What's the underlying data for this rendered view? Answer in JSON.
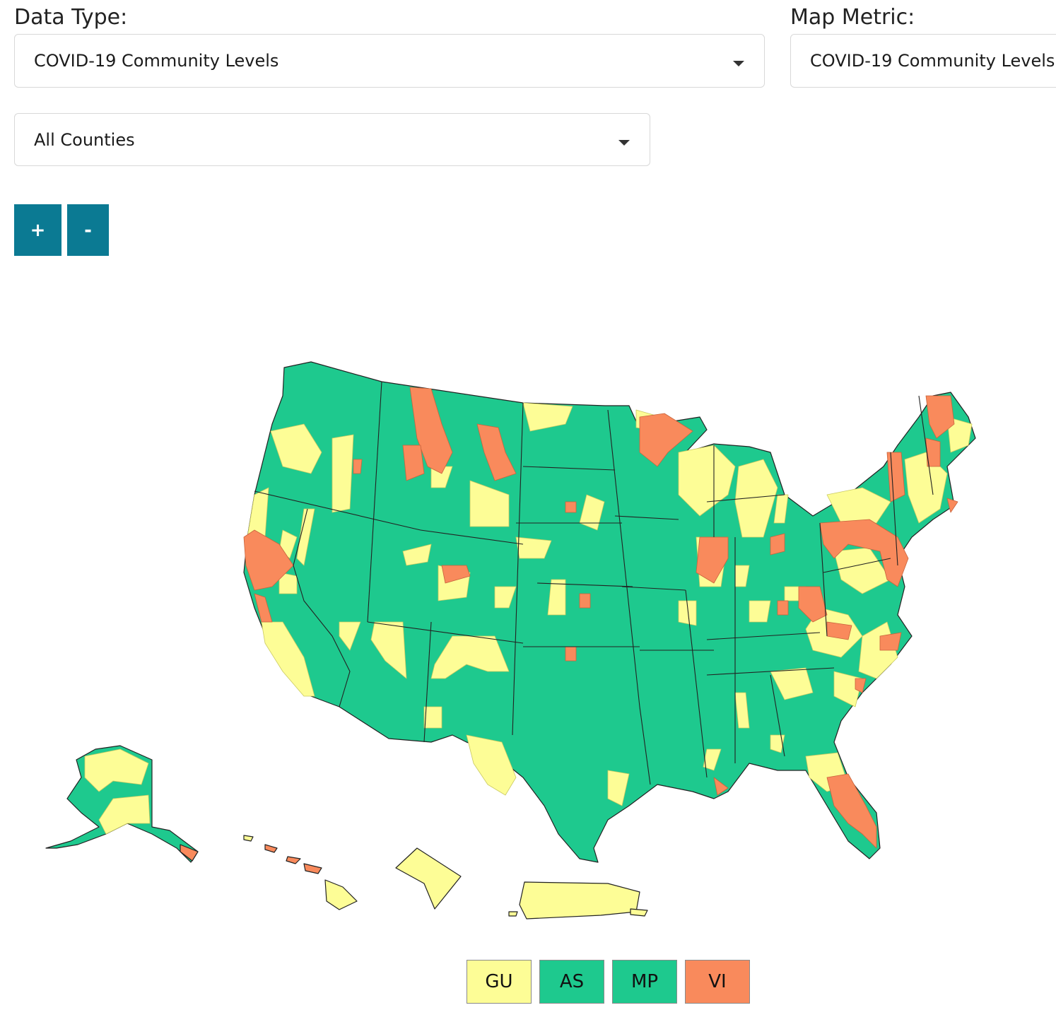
{
  "filters": {
    "data_type_label": "Data Type:",
    "data_type_value": "COVID-19 Community Levels",
    "map_metric_label": "Map Metric:",
    "map_metric_value": "COVID-19 Community Levels",
    "county_scope_value": "All Counties"
  },
  "zoom": {
    "zoom_in_label": "+",
    "zoom_out_label": "-"
  },
  "legend": [
    {
      "label": "GU",
      "color": "#fdfd96"
    },
    {
      "label": "AS",
      "color": "#1ec98e"
    },
    {
      "label": "MP",
      "color": "#1ec98e"
    },
    {
      "label": "VI",
      "color": "#f98a5c"
    }
  ],
  "map": {
    "colors": {
      "low": "#fdfd96",
      "medium": "#1ec98e",
      "high": "#f98a5c",
      "border": "#222222"
    },
    "icon": "us-county-choropleth-map"
  }
}
